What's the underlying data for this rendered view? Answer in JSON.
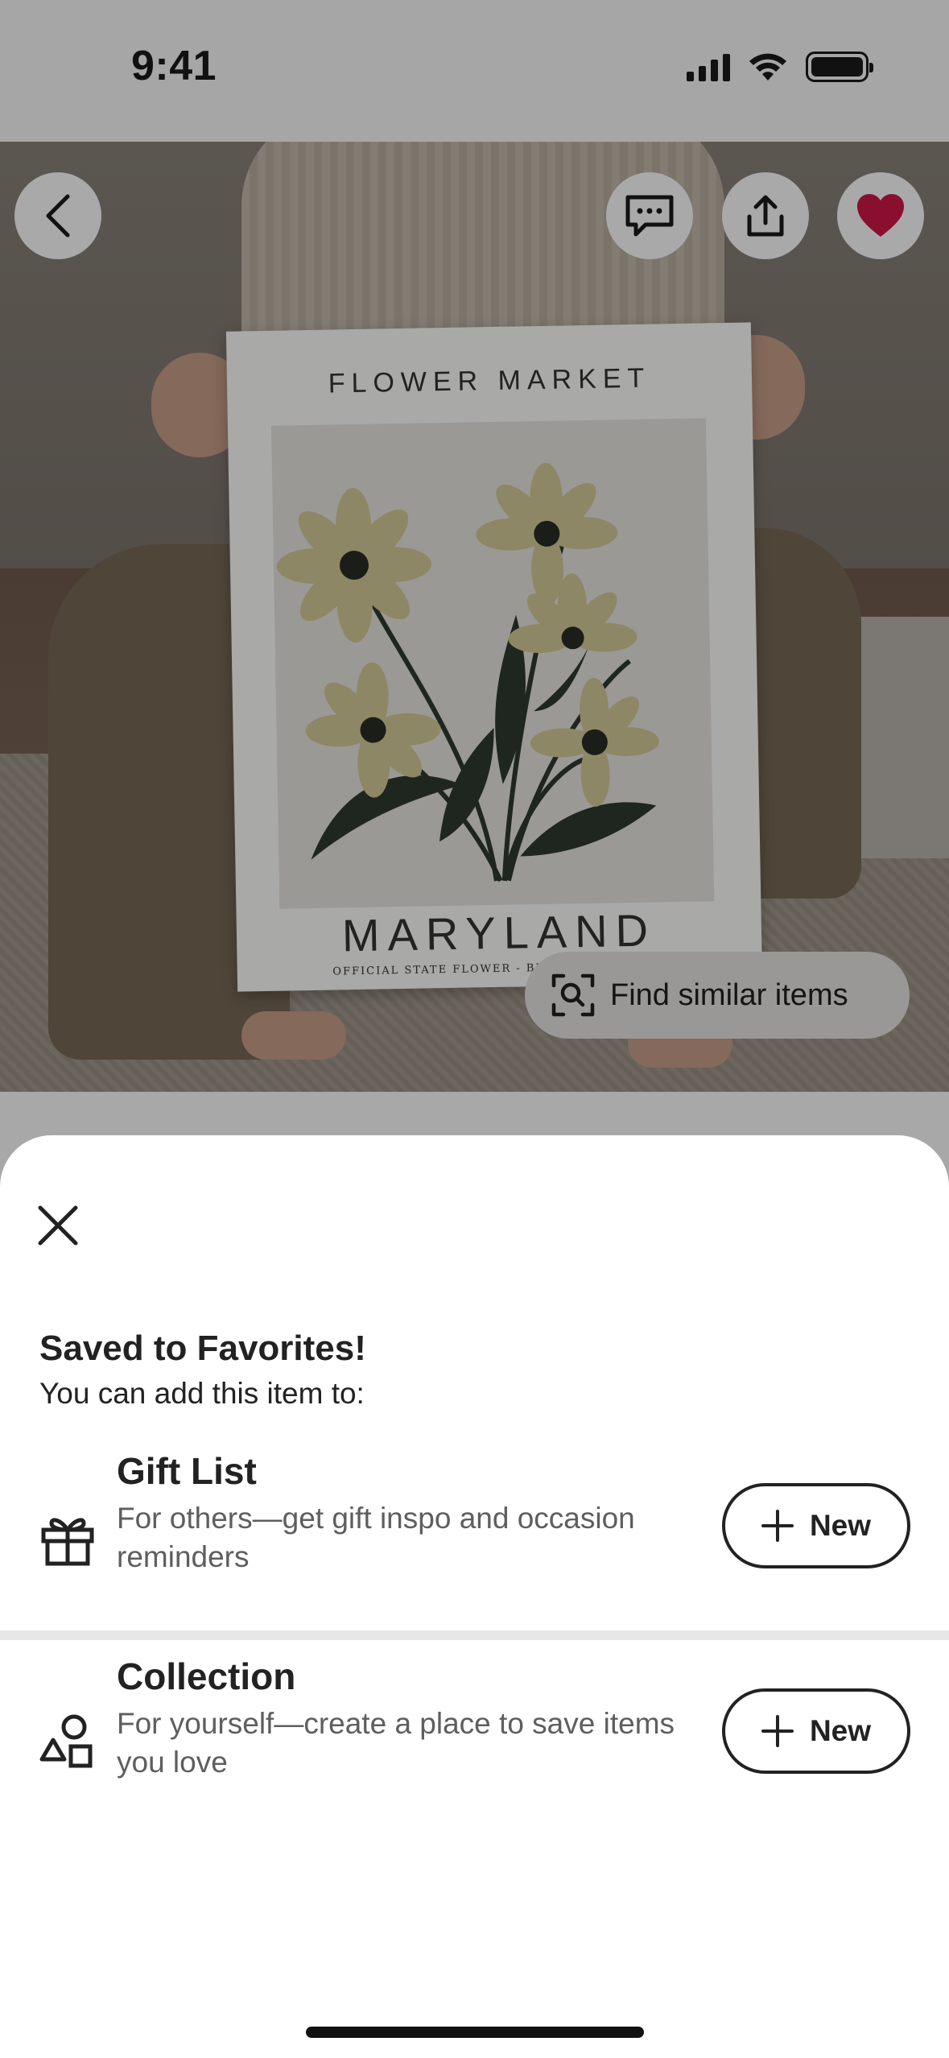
{
  "status_bar": {
    "time": "9:41"
  },
  "product_image": {
    "poster_title": "FLOWER MARKET",
    "poster_state": "MARYLAND",
    "poster_subtitle": "OFFICIAL STATE FLOWER - BLACK-EYED SUSAN",
    "find_similar_label": "Find similar items",
    "favorite_color": "#8a0f2e"
  },
  "sheet": {
    "heading": "Saved to Favorites!",
    "subheading": "You can add this item to:",
    "options": [
      {
        "title": "Gift List",
        "description": "For others—get gift inspo and occasion reminders",
        "button_label": "New",
        "icon": "gift-icon"
      },
      {
        "title": "Collection",
        "description": "For yourself—create a place to save items you love",
        "button_label": "New",
        "icon": "shapes-icon"
      }
    ]
  }
}
